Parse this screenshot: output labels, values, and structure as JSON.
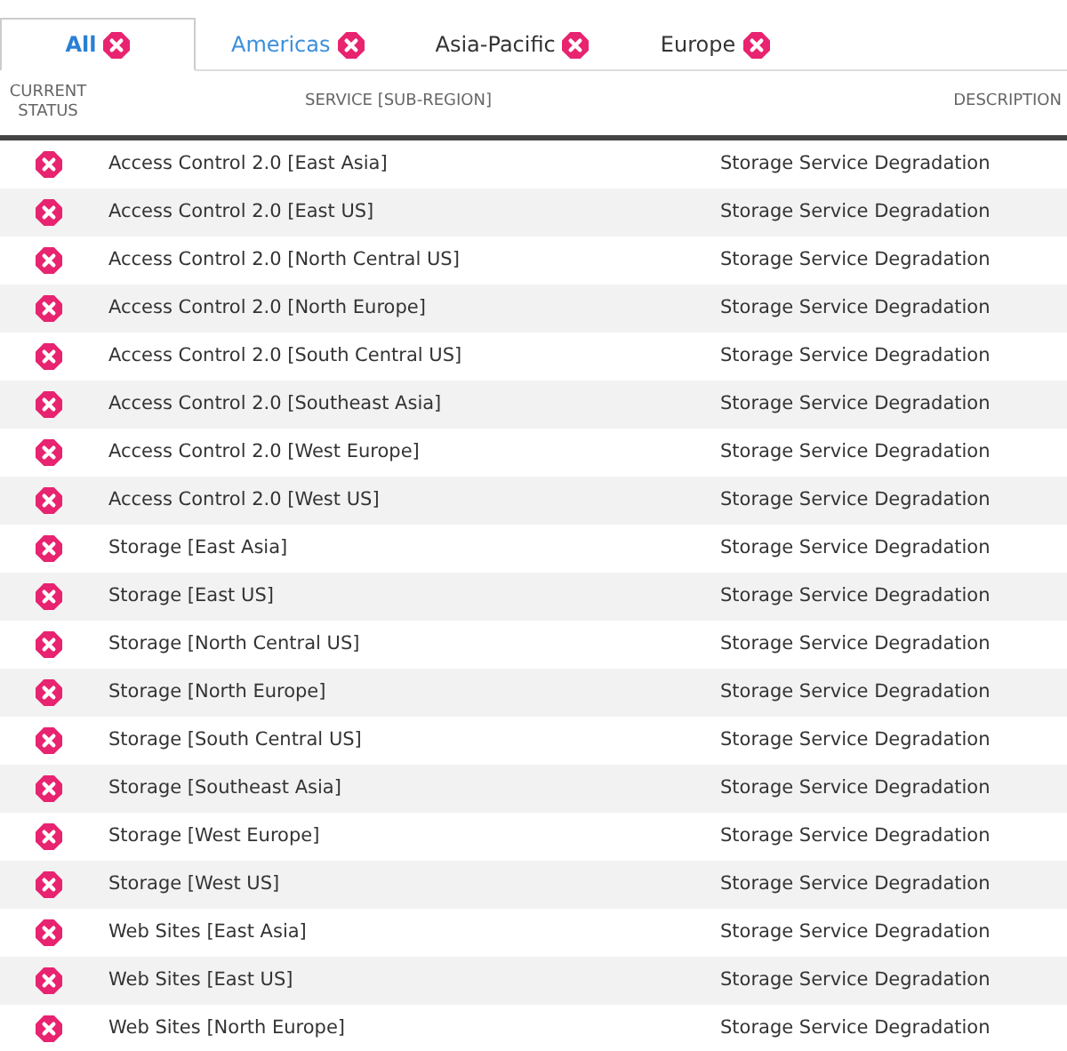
{
  "tabs": [
    {
      "label": "All",
      "selected": true,
      "hovered": false,
      "kind": "error"
    },
    {
      "label": "Americas",
      "selected": false,
      "hovered": true,
      "kind": "error"
    },
    {
      "label": "Asia-Pacific",
      "selected": false,
      "hovered": false,
      "kind": "error"
    },
    {
      "label": "Europe",
      "selected": false,
      "hovered": false,
      "kind": "error"
    }
  ],
  "table": {
    "columns": [
      "CURRENT STATUS",
      "SERVICE [SUB-REGION]",
      "DESCRIPTION"
    ],
    "rows": [
      {
        "kind": "error",
        "service": "Access Control 2.0 [East Asia]",
        "description": "Storage Service Degradation"
      },
      {
        "kind": "error",
        "service": "Access Control 2.0 [East US]",
        "description": "Storage Service Degradation"
      },
      {
        "kind": "error",
        "service": "Access Control 2.0 [North Central US]",
        "description": "Storage Service Degradation"
      },
      {
        "kind": "error",
        "service": "Access Control 2.0 [North Europe]",
        "description": "Storage Service Degradation"
      },
      {
        "kind": "error",
        "service": "Access Control 2.0 [South Central US]",
        "description": "Storage Service Degradation"
      },
      {
        "kind": "error",
        "service": "Access Control 2.0 [Southeast Asia]",
        "description": "Storage Service Degradation"
      },
      {
        "kind": "error",
        "service": "Access Control 2.0 [West Europe]",
        "description": "Storage Service Degradation"
      },
      {
        "kind": "error",
        "service": "Access Control 2.0 [West US]",
        "description": "Storage Service Degradation"
      },
      {
        "kind": "error",
        "service": "Storage [East Asia]",
        "description": "Storage Service Degradation"
      },
      {
        "kind": "error",
        "service": "Storage [East US]",
        "description": "Storage Service Degradation"
      },
      {
        "kind": "error",
        "service": "Storage [North Central US]",
        "description": "Storage Service Degradation"
      },
      {
        "kind": "error",
        "service": "Storage [North Europe]",
        "description": "Storage Service Degradation"
      },
      {
        "kind": "error",
        "service": "Storage [South Central US]",
        "description": "Storage Service Degradation"
      },
      {
        "kind": "error",
        "service": "Storage [Southeast Asia]",
        "description": "Storage Service Degradation"
      },
      {
        "kind": "error",
        "service": "Storage [West Europe]",
        "description": "Storage Service Degradation"
      },
      {
        "kind": "error",
        "service": "Storage [West US]",
        "description": "Storage Service Degradation"
      },
      {
        "kind": "error",
        "service": "Web Sites [East Asia]",
        "description": "Storage Service Degradation"
      },
      {
        "kind": "error",
        "service": "Web Sites [East US]",
        "description": "Storage Service Degradation"
      },
      {
        "kind": "error",
        "service": "Web Sites [North Europe]",
        "description": "Storage Service Degradation"
      }
    ]
  }
}
